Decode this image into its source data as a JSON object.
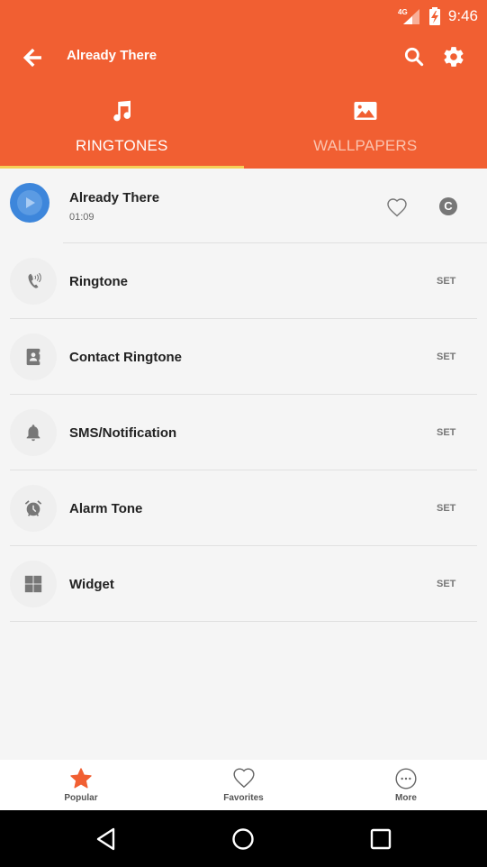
{
  "status_bar": {
    "network": "4G",
    "time": "9:46"
  },
  "app_bar": {
    "title": "Already There",
    "icons": [
      "back-arrow-icon",
      "search-icon",
      "gear-icon"
    ]
  },
  "tabs": [
    {
      "label": "RINGTONES",
      "icon": "music-note-icon",
      "active": true
    },
    {
      "label": "WALLPAPERS",
      "icon": "image-icon",
      "active": false
    }
  ],
  "colors": {
    "primary": "#f15f32",
    "tab_indicator": "#f6cf57",
    "play_button": "#3d86db"
  },
  "player": {
    "title": "Already There",
    "duration": "01:09",
    "c_badge": "C"
  },
  "options": [
    {
      "label": "Ringtone",
      "icon": "phone-ring-icon",
      "action": "SET"
    },
    {
      "label": "Contact Ringtone",
      "icon": "contact-book-icon",
      "action": "SET"
    },
    {
      "label": "SMS/Notification",
      "icon": "bell-icon",
      "action": "SET"
    },
    {
      "label": "Alarm Tone",
      "icon": "alarm-clock-icon",
      "action": "SET"
    },
    {
      "label": "Widget",
      "icon": "widget-grid-icon",
      "action": "SET"
    }
  ],
  "bottom_nav": [
    {
      "label": "Popular",
      "icon": "star-icon",
      "active": true
    },
    {
      "label": "Favorites",
      "icon": "heart-icon",
      "active": false
    },
    {
      "label": "More",
      "icon": "more-dots-icon",
      "active": false
    }
  ]
}
